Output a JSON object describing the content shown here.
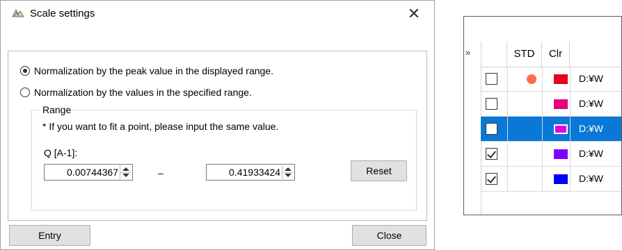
{
  "dialog": {
    "title": "Scale settings",
    "close_glyph": "✕",
    "icon": "scale-app-icon",
    "radio_options": [
      {
        "label": "Normalization by the peak value in the displayed range.",
        "checked": true
      },
      {
        "label": "Normalization by the values in the specified range.",
        "checked": false
      }
    ],
    "range": {
      "title": "Range",
      "note": "* If you want to fit a point, please input the same value.",
      "q_label": "Q [A-1]:",
      "min_value": "0.00744367",
      "dash": "–",
      "max_value": "0.41933424",
      "reset_label": "Reset"
    },
    "entry_label": "Entry",
    "close_label": "Close"
  },
  "grid": {
    "collapse_glyph": "»",
    "headers": [
      "STD",
      "Clr"
    ],
    "rows": [
      {
        "checked": false,
        "std": true,
        "color": "#e8001c",
        "path": "D:¥W",
        "selected": false
      },
      {
        "checked": false,
        "std": false,
        "color": "#e6007e",
        "path": "D:¥W",
        "selected": false
      },
      {
        "checked": false,
        "std": false,
        "color": "#e000e0",
        "path": "D:¥W",
        "selected": true
      },
      {
        "checked": true,
        "std": false,
        "color": "#7f00ff",
        "path": "D:¥W",
        "selected": false
      },
      {
        "checked": true,
        "std": false,
        "color": "#0000ff",
        "path": "D:¥W",
        "selected": false
      }
    ]
  }
}
